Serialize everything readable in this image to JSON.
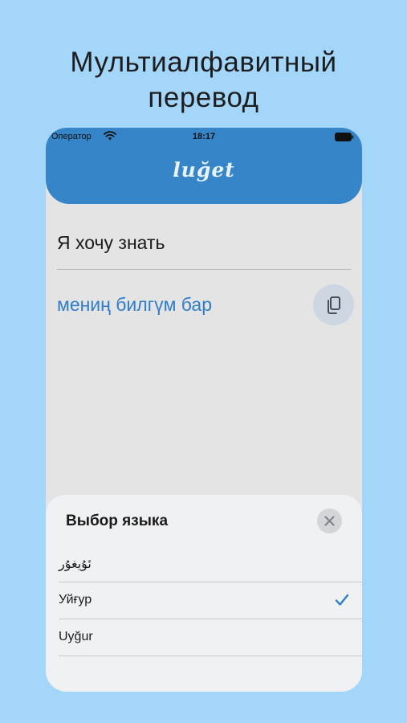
{
  "promo": {
    "title_line1": "Мультиалфавитный",
    "title_line2": "перевод"
  },
  "status_bar": {
    "carrier": "Оператор",
    "time": "18:17"
  },
  "header": {
    "logo": "luğet",
    "color": "#3585c8"
  },
  "translator": {
    "source_text": "Я хочу знать",
    "translated_text": "мениң билгүм бар",
    "translated_color": "#2f7dc9"
  },
  "language_sheet": {
    "title": "Выбор языка",
    "options": [
      {
        "label": "ئۇيغۇر",
        "selected": false
      },
      {
        "label": "Уйғур",
        "selected": true
      },
      {
        "label": "Uyğur",
        "selected": false
      }
    ],
    "accent": "#2f7dc9"
  },
  "icons": {
    "wifi": "wifi-icon",
    "battery": "battery-icon",
    "copy": "copy-icon",
    "close": "close-icon",
    "check": "checkmark-icon"
  }
}
